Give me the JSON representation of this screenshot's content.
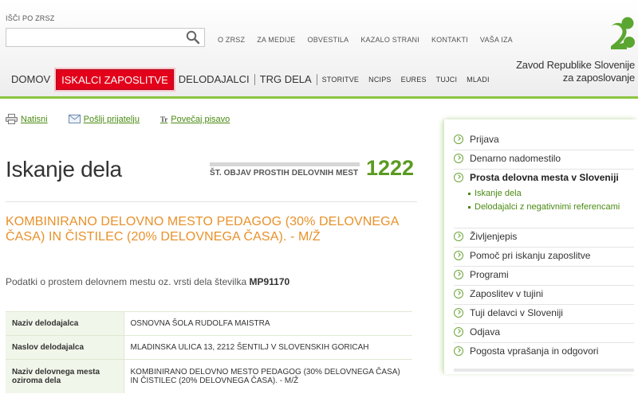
{
  "search": {
    "label": "IŠČI PO ZRSZ",
    "value": "",
    "placeholder": ""
  },
  "top_links": [
    "O ZRSZ",
    "ZA MEDIJE",
    "OBVESTILA",
    "KAZALO STRANI",
    "KONTAKTI",
    "VAŠA IZA"
  ],
  "org": {
    "name_line1": "Zavod Republike Slovenije",
    "name_line2": "za zaposlovanje"
  },
  "main_nav": {
    "big": [
      "DOMOV",
      "ISKALCI ZAPOSLITVE",
      "DELODAJALCI",
      "TRG DELA"
    ],
    "small": [
      "STORITVE",
      "NCIPS",
      "EURES",
      "TUJCI",
      "MLADI"
    ],
    "active": "ISKALCI ZAPOSLITVE"
  },
  "toolbar": {
    "print": "Natisni",
    "send": "Pošlji prijatelju",
    "font": "Povečaj pisavo",
    "font_icon": "Tr"
  },
  "page": {
    "title": "Iskanje dela",
    "counter_label": "ŠT. OBJAV PROSTIH DELOVNIH MEST",
    "counter_value": "1222"
  },
  "job": {
    "title": "KOMBINIRANO DELOVNO MESTO PEDAGOG (30% DELOVNEGA ČASA) IN ČISTILEC (20% DELOVNEGA ČASA). - M/Ž",
    "intro_text": "Podatki o prostem delovnem mestu oz. vrsti dela številka",
    "intro_number": "MP91170",
    "details": [
      {
        "key": "Naziv delodajalca",
        "value": "OSNOVNA ŠOLA RUDOLFA MAISTRA"
      },
      {
        "key": "Naslov delodajalca",
        "value": "MLADINSKA ULICA 13, 2212 ŠENTILJ V SLOVENSKIH GORICAH"
      },
      {
        "key": "Naziv delovnega mesta oziroma dela",
        "value": "KOMBINIRANO DELOVNO MESTO PEDAGOG (30% DELOVNEGA ČASA) IN ČISTILEC (20% DELOVNEGA ČASA). - M/Ž"
      }
    ]
  },
  "sidebar": {
    "items": [
      {
        "label": "Prijava"
      },
      {
        "label": "Denarno nadomestilo"
      },
      {
        "label": "Prosta delovna mesta v Sloveniji",
        "current": true
      },
      {
        "label": "Življenjepis"
      },
      {
        "label": "Pomoč pri iskanju zaposlitve"
      },
      {
        "label": "Programi"
      },
      {
        "label": "Zaposlitev v tujini"
      },
      {
        "label": "Tuji delavci v Sloveniji"
      },
      {
        "label": "Odjava"
      },
      {
        "label": "Pogosta vprašanja in odgovori"
      }
    ],
    "sub_items": [
      "Iskanje dela",
      "Delodajalci z negativnimi referencami"
    ]
  },
  "colors": {
    "brand_green": "#5a9a22",
    "accent_red": "#e2001a",
    "job_orange": "#e8912a"
  }
}
